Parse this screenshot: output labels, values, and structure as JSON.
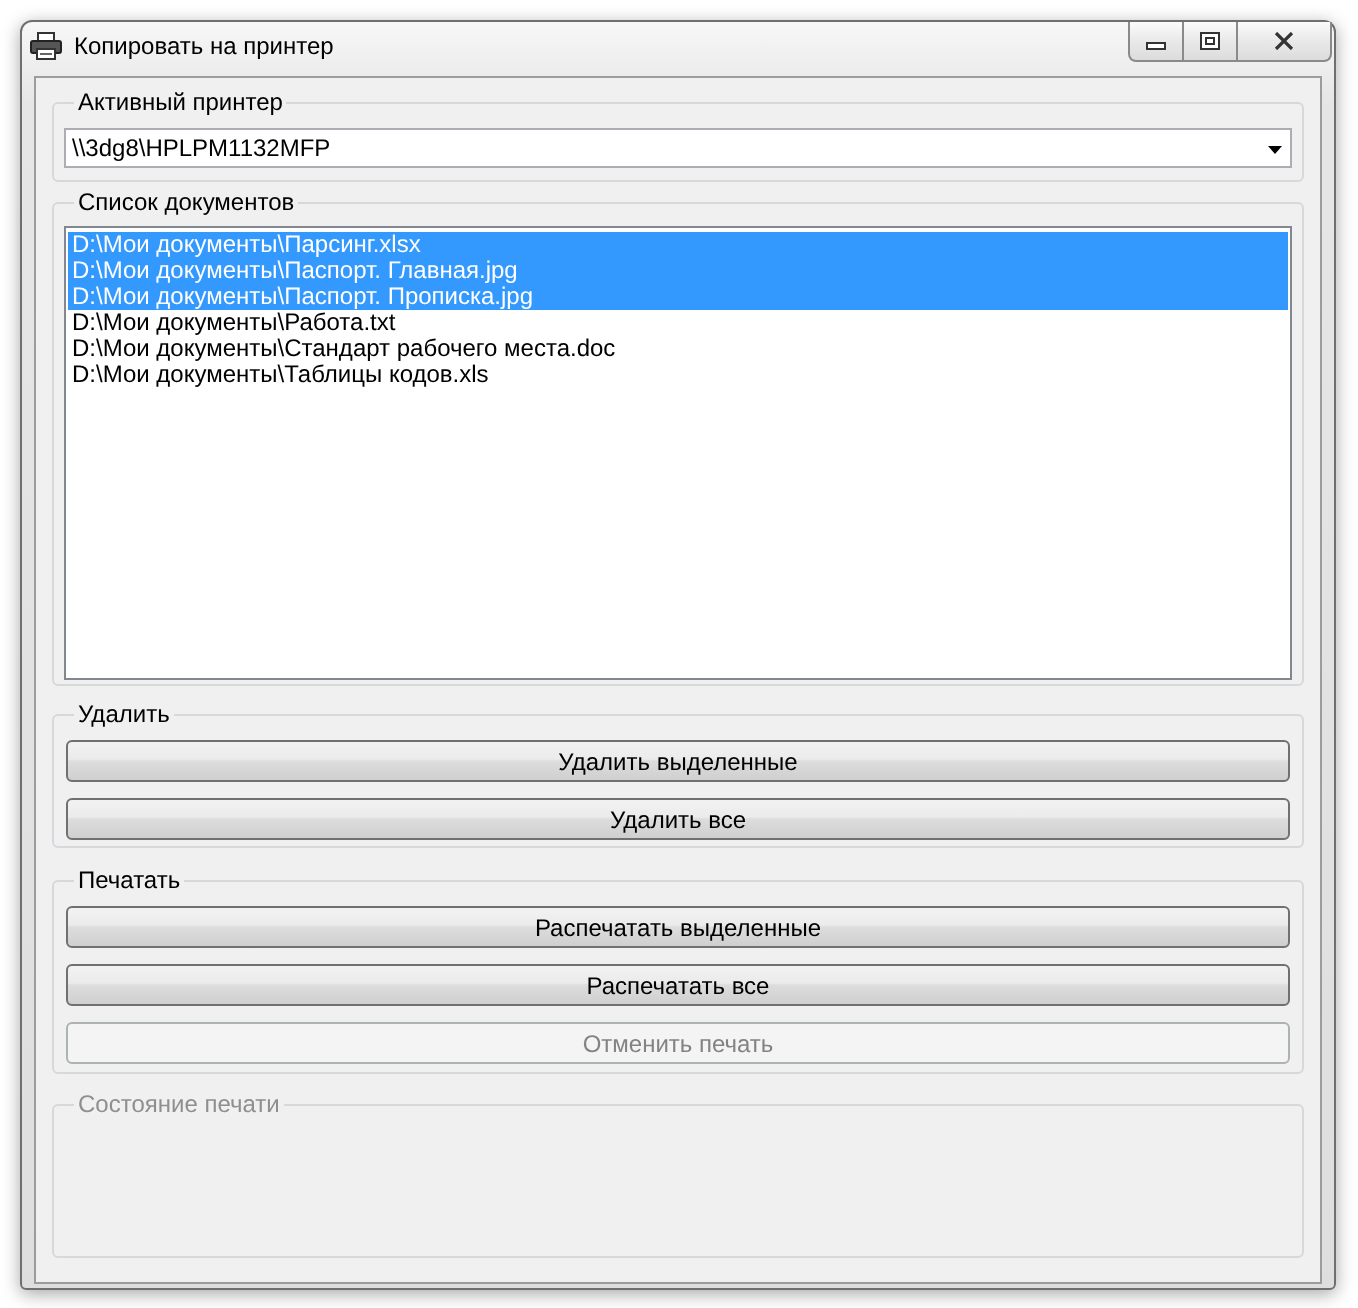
{
  "window": {
    "title": "Копировать на принтер"
  },
  "printer_group": {
    "label": "Активный принтер",
    "printer_select": {
      "value": "\\\\3dg8\\HPLPM1132MFP"
    }
  },
  "documents_group": {
    "label": "Список документов",
    "items": [
      {
        "text": "D:\\Мои документы\\Парсинг.xlsx",
        "selected": true
      },
      {
        "text": "D:\\Мои документы\\Паспорт. Главная.jpg",
        "selected": true
      },
      {
        "text": "D:\\Мои документы\\Паспорт. Прописка.jpg",
        "selected": true
      },
      {
        "text": "D:\\Мои документы\\Работа.txt",
        "selected": false
      },
      {
        "text": "D:\\Мои документы\\Стандарт рабочего места.doc",
        "selected": false
      },
      {
        "text": "D:\\Мои документы\\Таблицы кодов.xls",
        "selected": false
      }
    ]
  },
  "delete_group": {
    "label": "Удалить",
    "buttons": [
      {
        "label": "Удалить выделенные",
        "disabled": false
      },
      {
        "label": "Удалить все",
        "disabled": false
      }
    ]
  },
  "print_group": {
    "label": "Печатать",
    "buttons": [
      {
        "label": "Распечатать выделенные",
        "disabled": false
      },
      {
        "label": "Распечатать все",
        "disabled": false
      },
      {
        "label": "Отменить печать",
        "disabled": true
      }
    ]
  },
  "status_group": {
    "label": "Состояние печати",
    "disabled": true
  }
}
